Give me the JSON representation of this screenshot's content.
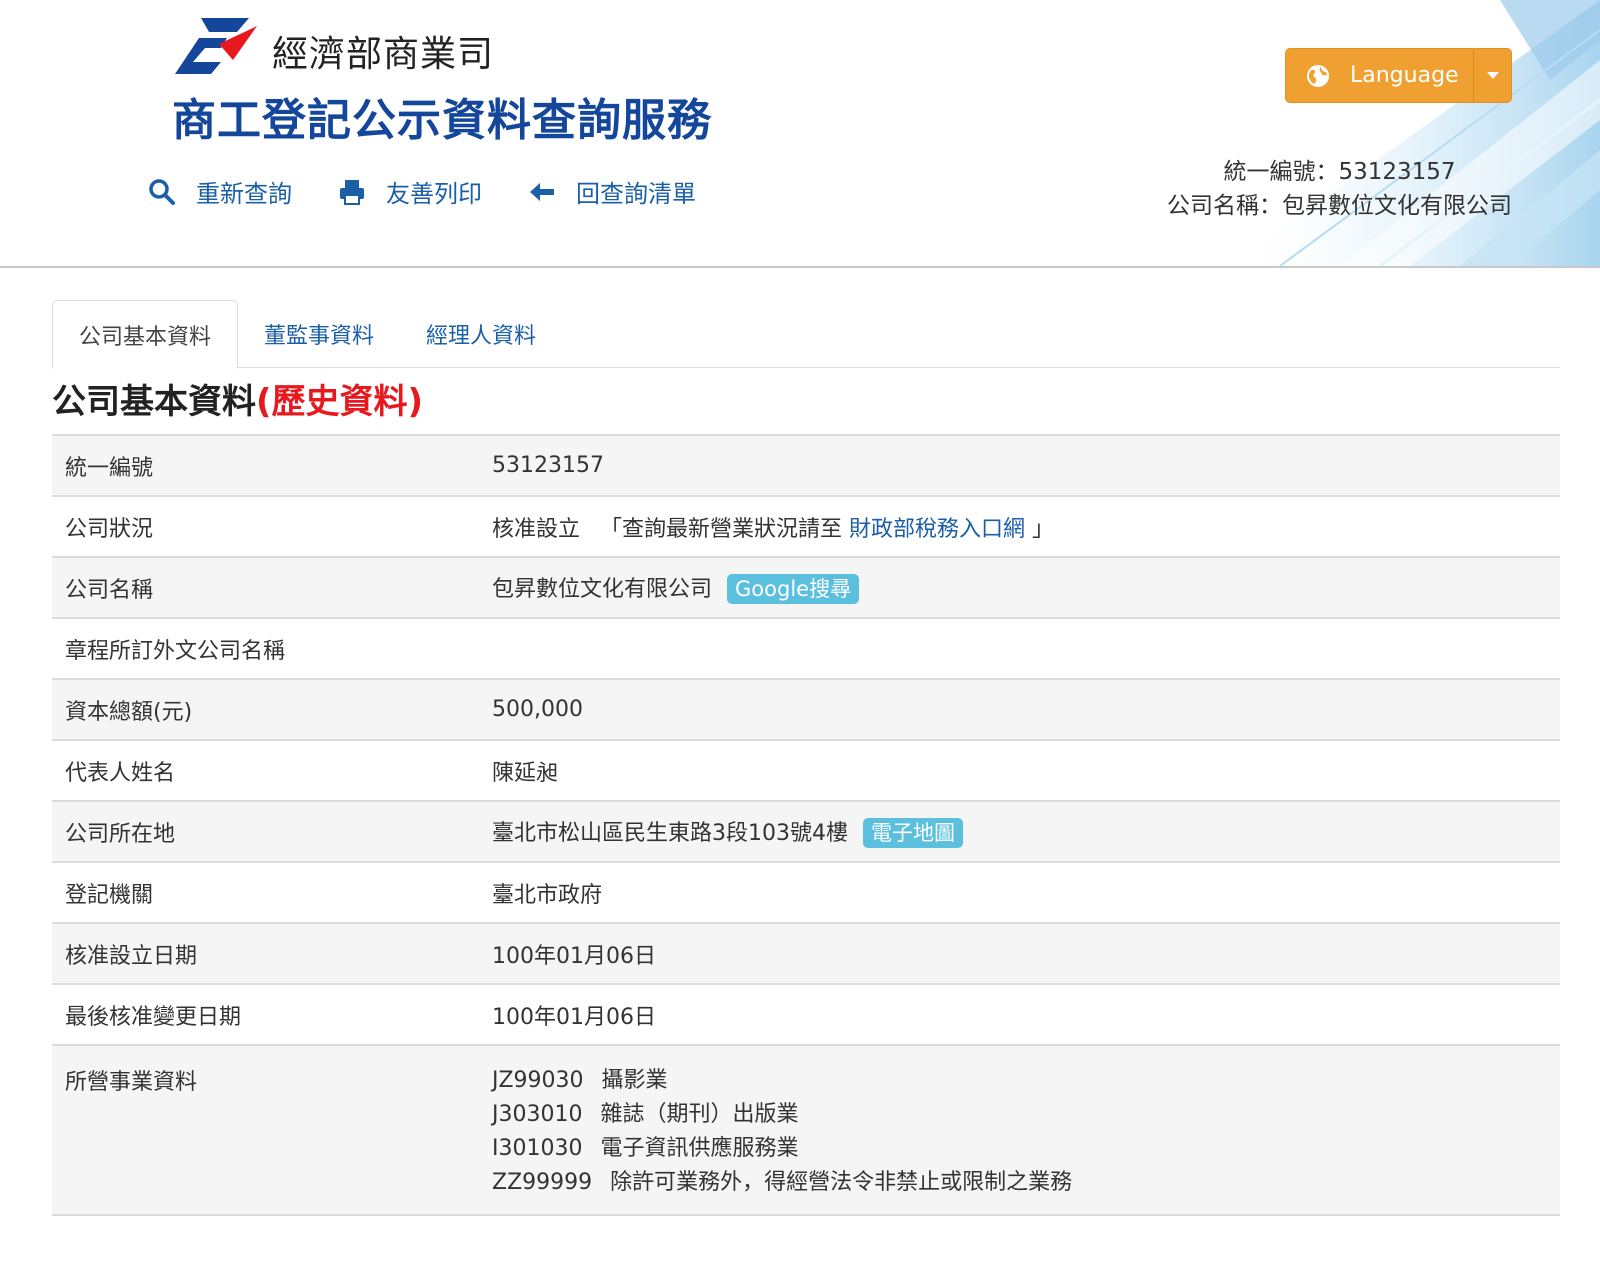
{
  "header": {
    "dept_name": "經濟部商業司",
    "site_title": "商工登記公示資料查詢服務",
    "nav": [
      {
        "label": "重新查詢",
        "icon": "search-icon"
      },
      {
        "label": "友善列印",
        "icon": "print-icon"
      },
      {
        "label": "回查詢清單",
        "icon": "arrow-left-icon"
      }
    ],
    "language_button": {
      "label": "Language",
      "icon": "globe-icon"
    },
    "company_id_line": "統一編號：53123157",
    "company_name_line": "公司名稱：包昇數位文化有限公司"
  },
  "tabs": [
    "公司基本資料",
    "董監事資料",
    "經理人資料"
  ],
  "active_tab": "公司基本資料",
  "section": {
    "title": "公司基本資料",
    "history_label": "(歷史資料)"
  },
  "rows": {
    "tax_id": {
      "label": "統一編號",
      "value": "53123157"
    },
    "status": {
      "label": "公司狀況",
      "value": "核准設立",
      "prefix": "「查詢最新營業狀況請至",
      "link": "財政部稅務入口網",
      "suffix": "」"
    },
    "name": {
      "label": "公司名稱",
      "value": "包昇數位文化有限公司",
      "badge": "Google搜尋"
    },
    "foreign_name": {
      "label": "章程所訂外文公司名稱",
      "value": ""
    },
    "capital": {
      "label": "資本總額(元)",
      "value": "500,000"
    },
    "representative": {
      "label": "代表人姓名",
      "value": "陳延昶"
    },
    "address": {
      "label": "公司所在地",
      "value": "臺北市松山區民生東路3段103號4樓",
      "badge": "電子地圖"
    },
    "authority": {
      "label": "登記機關",
      "value": "臺北市政府"
    },
    "approval_date": {
      "label": "核准設立日期",
      "value": "100年01月06日"
    },
    "last_change_date": {
      "label": "最後核准變更日期",
      "value": "100年01月06日"
    },
    "business": {
      "label": "所營事業資料",
      "items": [
        {
          "code": "JZ99030",
          "desc": "攝影業"
        },
        {
          "code": "J303010",
          "desc": "雜誌（期刊）出版業"
        },
        {
          "code": "I301030",
          "desc": "電子資訊供應服務業"
        },
        {
          "code": "ZZ99999",
          "desc": "除許可業務外，得經營法令非禁止或限制之業務"
        }
      ]
    }
  },
  "colors": {
    "brand_blue": "#14479b",
    "link_blue": "#1a5fa8",
    "language_orange": "#f0a030",
    "history_red": "#e8191e",
    "badge_cyan": "#5bc0de"
  }
}
